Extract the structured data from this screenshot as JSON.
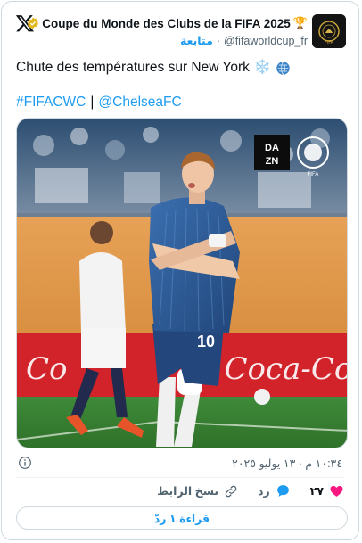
{
  "header": {
    "account_name": "Coupe du Monde des Clubs de la FIFA 2025",
    "trophy_emoji": "🏆",
    "handle": "@fifaworldcup_fr",
    "separator": "·",
    "follow_label": "متابعة",
    "avatar_text": "FIFA"
  },
  "tweet": {
    "text": "Chute des températures sur New York",
    "emojis": "❄️",
    "hashtag": "#FIFACWC",
    "divider": "|",
    "mention": "@ChelseaFC"
  },
  "media": {
    "broadcaster_logo": "DAZN",
    "jersey_number": "10",
    "watermark": "FIFA"
  },
  "meta": {
    "timestamp": "١٠:٣٤ م · ١٣ يوليو ٢٠٢٥"
  },
  "actions": {
    "likes_count": "٢٧",
    "reply_label": "رد",
    "copy_link_label": "نسخ الرابط"
  },
  "read_replies_label": "قراءة ١ ردّ",
  "colors": {
    "accent": "#1d9bf0",
    "like": "#f91880",
    "verified_gold": "#e2b719"
  }
}
